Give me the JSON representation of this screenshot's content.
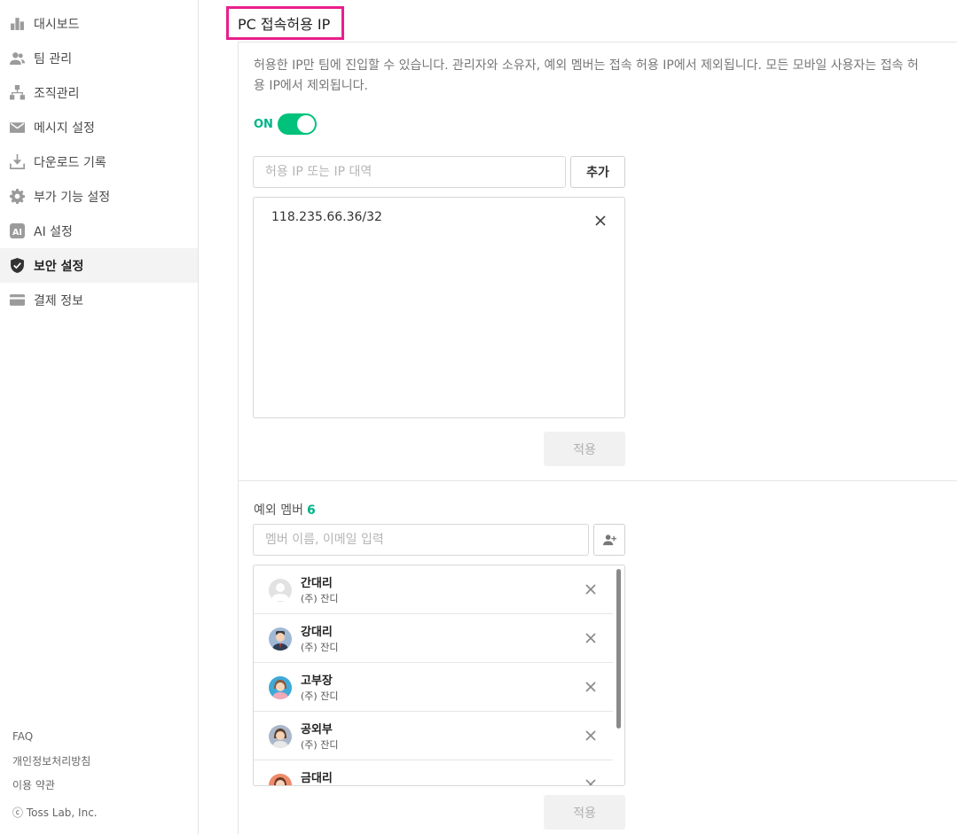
{
  "sidebar": {
    "items": [
      {
        "label": "대시보드",
        "icon": "bar-chart-icon"
      },
      {
        "label": "팀 관리",
        "icon": "people-icon"
      },
      {
        "label": "조직관리",
        "icon": "org-chart-icon"
      },
      {
        "label": "메시지 설정",
        "icon": "envelope-icon"
      },
      {
        "label": "다운로드 기록",
        "icon": "download-icon"
      },
      {
        "label": "부가 기능 설정",
        "icon": "gear-icon"
      },
      {
        "label": "AI 설정",
        "icon": "ai-icon"
      },
      {
        "label": "보안 설정",
        "icon": "shield-icon",
        "active": true
      },
      {
        "label": "결제 정보",
        "icon": "credit-card-icon"
      }
    ],
    "footer": {
      "faq": "FAQ",
      "privacy": "개인정보처리방침",
      "terms": "이용 약관",
      "copyright": "ⓒ Toss Lab, Inc."
    }
  },
  "main": {
    "title": "PC 접속허용 IP",
    "description": "허용한 IP만 팀에 진입할 수 있습니다. 관리자와 소유자, 예외 멤버는 접속 허용 IP에서 제외됩니다. 모든 모바일 사용자는 접속 허용 IP에서 제외됩니다.",
    "toggle": {
      "label": "ON",
      "state": "on"
    },
    "ip_input": {
      "placeholder": "허용 IP 또는 IP 대역",
      "value": ""
    },
    "add_button": "추가",
    "ip_list": [
      "118.235.66.36/32"
    ],
    "apply_button": "적용",
    "exception": {
      "label": "예외 멤버",
      "count": "6",
      "search_placeholder": "멤버 이름, 이메일 입력",
      "members": [
        {
          "name": "간대리",
          "org": "(주) 잔디"
        },
        {
          "name": "강대리",
          "org": "(주) 잔디"
        },
        {
          "name": "고부장",
          "org": "(주) 잔디"
        },
        {
          "name": "공외부",
          "org": "(주) 잔디"
        },
        {
          "name": "금대리",
          "org": ""
        }
      ],
      "apply_button": "적용"
    }
  },
  "colors": {
    "accent": "#00c27a",
    "highlight_border": "#e91e8c"
  }
}
